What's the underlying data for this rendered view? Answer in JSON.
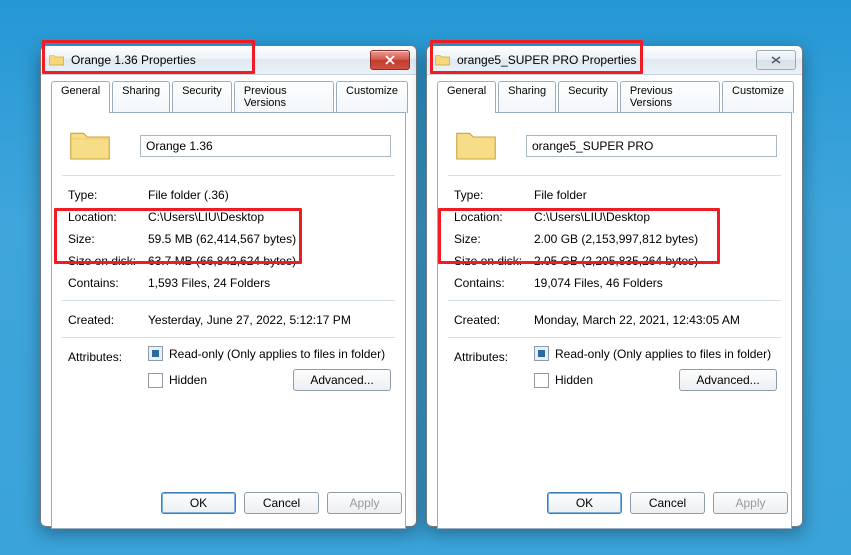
{
  "tabs": {
    "general": "General",
    "sharing": "Sharing",
    "security": "Security",
    "previous": "Previous Versions",
    "customize": "Customize"
  },
  "labels": {
    "type": "Type:",
    "location": "Location:",
    "size": "Size:",
    "size_on_disk": "Size on disk:",
    "contains": "Contains:",
    "created": "Created:",
    "attributes": "Attributes:",
    "readonly": "Read-only (Only applies to files in folder)",
    "hidden": "Hidden",
    "advanced": "Advanced...",
    "ok": "OK",
    "cancel": "Cancel",
    "apply": "Apply"
  },
  "left": {
    "title": "Orange 1.36 Properties",
    "name": "Orange 1.36",
    "type": "File folder (.36)",
    "location": "C:\\Users\\LIU\\Desktop",
    "size": "59.5 MB (62,414,567 bytes)",
    "size_on_disk": "63.7 MB (66,842,624 bytes)",
    "contains": "1,593 Files, 24 Folders",
    "created": "Yesterday, June 27, 2022, 5:12:17 PM"
  },
  "right": {
    "title": "orange5_SUPER PRO Properties",
    "name": "orange5_SUPER PRO",
    "type": "File folder",
    "location": "C:\\Users\\LIU\\Desktop",
    "size": "2.00 GB (2,153,997,812 bytes)",
    "size_on_disk": "2.05 GB (2,205,835,264 bytes)",
    "contains": "19,074 Files, 46 Folders",
    "created": "Monday, March 22, 2021, 12:43:05 AM"
  }
}
